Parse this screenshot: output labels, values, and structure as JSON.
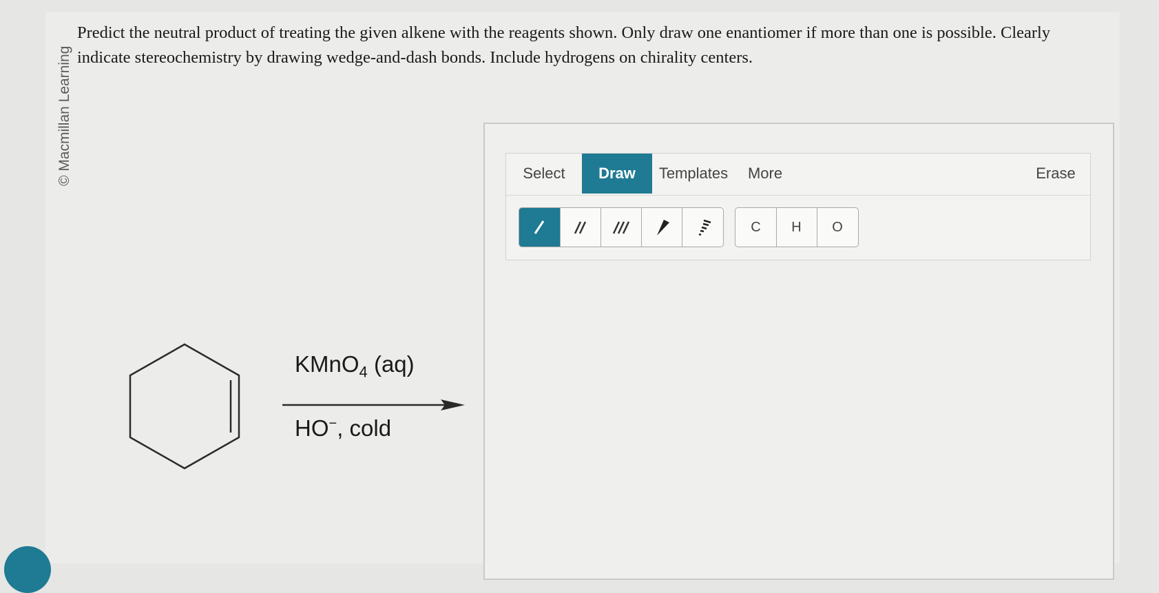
{
  "watermark": "© Macmillan Learning",
  "question": "Predict the neutral product of treating the given alkene with the reagents shown. Only draw one enantiomer if more than one is possible. Clearly indicate stereochemistry by drawing wedge-and-dash bonds. Include hydrogens on chirality centers.",
  "reaction": {
    "reagent_main": "KMnO",
    "reagent_sub": "4",
    "reagent_suffix": " (aq)",
    "conditions_base": "HO",
    "conditions_charge": "−",
    "conditions_suffix": ", cold"
  },
  "toolbar": {
    "tabs": {
      "select": "Select",
      "draw": "Draw",
      "templates": "Templates",
      "more": "More",
      "erase": "Erase"
    },
    "atoms": {
      "c": "C",
      "h": "H",
      "o": "O"
    },
    "accent_color": "#1f7a93"
  }
}
